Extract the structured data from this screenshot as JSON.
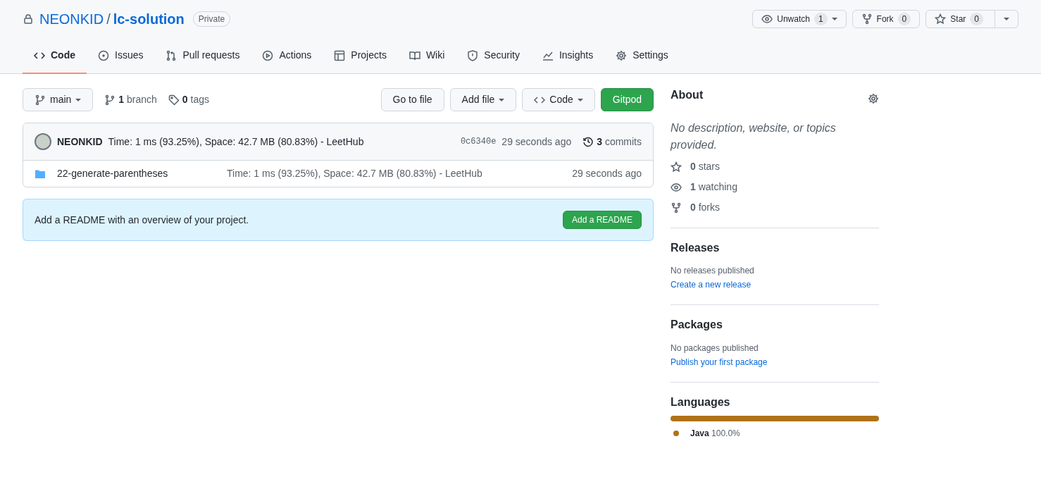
{
  "repo": {
    "owner": "NEONKID",
    "separator": "/",
    "name": "lc-solution",
    "visibility": "Private"
  },
  "repo_actions": [
    {
      "kind": "watch",
      "label": "Unwatch",
      "count": "1"
    },
    {
      "kind": "fork",
      "label": "Fork",
      "count": "0"
    },
    {
      "kind": "star",
      "label": "Star",
      "count": "0"
    }
  ],
  "tabs": [
    {
      "kind": "code",
      "label": "Code",
      "selected": true
    },
    {
      "kind": "issues",
      "label": "Issues",
      "selected": false
    },
    {
      "kind": "pulls",
      "label": "Pull requests",
      "selected": false
    },
    {
      "kind": "actions",
      "label": "Actions",
      "selected": false
    },
    {
      "kind": "projects",
      "label": "Projects",
      "selected": false
    },
    {
      "kind": "wiki",
      "label": "Wiki",
      "selected": false
    },
    {
      "kind": "security",
      "label": "Security",
      "selected": false
    },
    {
      "kind": "insights",
      "label": "Insights",
      "selected": false
    },
    {
      "kind": "settings",
      "label": "Settings",
      "selected": false
    }
  ],
  "branch_bar": {
    "branch": "main",
    "branches": {
      "count": "1",
      "label": "branch"
    },
    "tags": {
      "count": "0",
      "label": "tags"
    },
    "buttons": [
      {
        "kind": "plain",
        "label": "Go to file"
      },
      {
        "kind": "dropdown",
        "label": "Add file"
      },
      {
        "kind": "code",
        "label": "Code"
      },
      {
        "kind": "primary",
        "label": "Gitpod"
      }
    ]
  },
  "latest_commit": {
    "author": "NEONKID",
    "message": "Time: 1 ms (93.25%), Space: 42.7 MB (80.83%) - LeetHub",
    "sha": "0c6340e",
    "time": "29 seconds ago",
    "commits": {
      "count": "3",
      "label": "commits"
    }
  },
  "files": [
    {
      "name": "22-generate-parentheses",
      "message": "Time: 1 ms (93.25%), Space: 42.7 MB (80.83%) - LeetHub",
      "time": "29 seconds ago"
    }
  ],
  "readme_notice": {
    "text": "Add a README with an overview of your project.",
    "button": "Add a README"
  },
  "about": {
    "title": "About",
    "description": "No description, website, or topics provided.",
    "stats": [
      {
        "kind": "star",
        "count": "0",
        "label": "stars"
      },
      {
        "kind": "eye",
        "count": "1",
        "label": "watching"
      },
      {
        "kind": "fork",
        "count": "0",
        "label": "forks"
      }
    ]
  },
  "releases": {
    "title": "Releases",
    "note": "No releases published",
    "link": "Create a new release"
  },
  "packages": {
    "title": "Packages",
    "note": "No packages published",
    "link": "Publish your first package"
  },
  "languages": {
    "title": "Languages",
    "items": [
      {
        "name": "Java",
        "percent": "100.0%",
        "color": "#b07219",
        "level": 1
      }
    ]
  }
}
